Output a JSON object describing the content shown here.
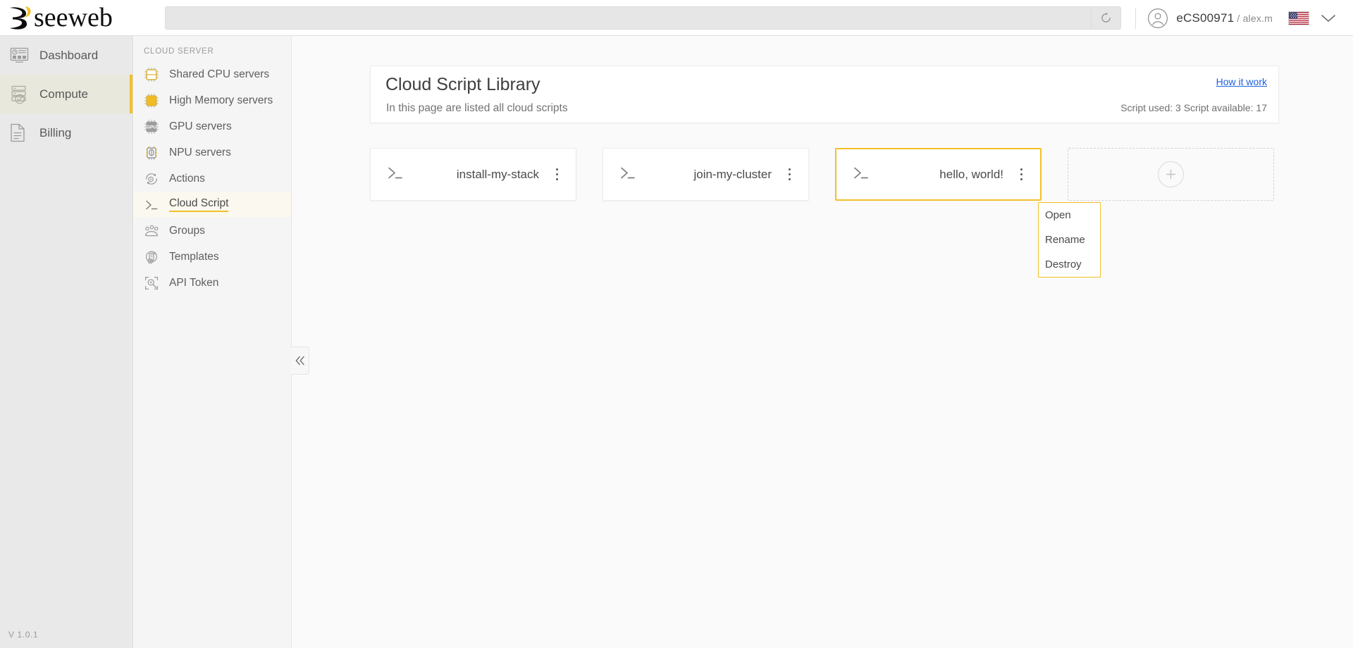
{
  "brand": {
    "name": "seeweb",
    "accent_color": "#f2c029"
  },
  "topbar": {
    "search": {
      "value": "",
      "placeholder": ""
    },
    "refresh_icon": "refresh-icon",
    "account": {
      "avatar_icon": "user-avatar-icon",
      "id": "eCS00971",
      "separator": "/",
      "username": "alex.m"
    },
    "language": {
      "flag": "us-flag-icon",
      "chevron": "chevron-down-icon"
    }
  },
  "sidebar_primary": {
    "items": [
      {
        "label": "Dashboard",
        "icon": "dashboard-icon",
        "active": false
      },
      {
        "label": "Compute",
        "icon": "server-clock-icon",
        "active": true
      },
      {
        "label": "Billing",
        "icon": "document-icon",
        "active": false
      }
    ],
    "version": "V 1.0.1"
  },
  "sidebar_secondary": {
    "title": "CLOUD SERVER",
    "items": [
      {
        "label": "Shared CPU servers",
        "icon": "cpu-chip-outline-icon",
        "active": false
      },
      {
        "label": "High Memory servers",
        "icon": "cpu-chip-filled-icon",
        "active": false
      },
      {
        "label": "GPU servers",
        "icon": "gpu-chip-icon",
        "active": false
      },
      {
        "label": "NPU servers",
        "icon": "npu-chip-icon",
        "active": false
      },
      {
        "label": "Actions",
        "icon": "actions-gear-icon",
        "active": false
      },
      {
        "label": "Cloud Script",
        "icon": "terminal-prompt-icon",
        "active": true
      },
      {
        "label": "Groups",
        "icon": "groups-people-icon",
        "active": false
      },
      {
        "label": "Templates",
        "icon": "templates-icon",
        "active": false
      },
      {
        "label": "API Token",
        "icon": "api-token-icon",
        "active": false
      }
    ]
  },
  "collapse": {
    "icon": "double-chevron-left-icon"
  },
  "main": {
    "page_title": "Cloud Script Library",
    "page_subtitle": "In this page are listed all cloud scripts",
    "how_it_works_link": "How it work",
    "quota_text": "Script used: 3 Script available: 17",
    "scripts": [
      {
        "name": "install-my-stack",
        "icon": "terminal-prompt-icon",
        "selected": false
      },
      {
        "name": "join-my-cluster",
        "icon": "terminal-prompt-icon",
        "selected": false
      },
      {
        "name": "hello, world!",
        "icon": "terminal-prompt-icon",
        "selected": true
      }
    ],
    "add_card": {
      "icon": "plus-circle-icon"
    },
    "context_menu": {
      "open": true,
      "items": [
        {
          "label": "Open"
        },
        {
          "label": "Rename"
        },
        {
          "label": "Destroy"
        }
      ]
    }
  }
}
